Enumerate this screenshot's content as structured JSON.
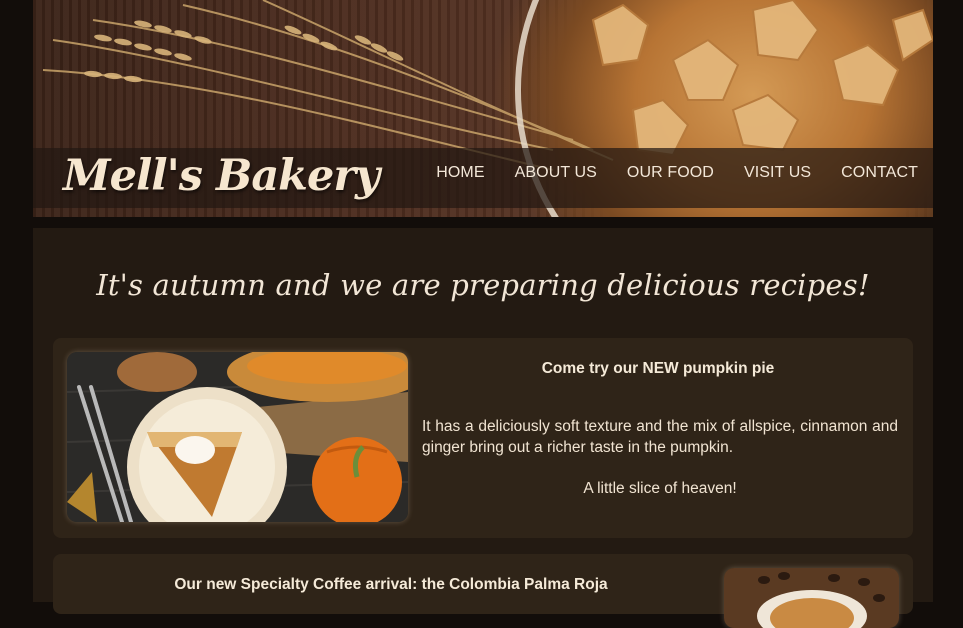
{
  "brand": {
    "logo_text": "Mell's Bakery"
  },
  "nav": {
    "items": [
      {
        "label": "HOME"
      },
      {
        "label": "ABOUT US"
      },
      {
        "label": "OUR FOOD"
      },
      {
        "label": "VISIT US"
      },
      {
        "label": "CONTACT"
      }
    ]
  },
  "main": {
    "headline": "It's autumn and we are preparing delicious recipes!",
    "cards": [
      {
        "title": "Come try our NEW pumpkin pie",
        "body": "It has a deliciously soft texture and the mix of allspice, cinnamon and ginger bring out a richer taste in the pumpkin.",
        "note": "A little slice of heaven!"
      },
      {
        "title": "Our new Specialty Coffee arrival: the Colombia Palma Roja"
      }
    ]
  },
  "colors": {
    "page_background": "#120d0a",
    "content_background": "#231a12",
    "card_background": "#2f2418",
    "text_light": "#f3e7d8"
  }
}
